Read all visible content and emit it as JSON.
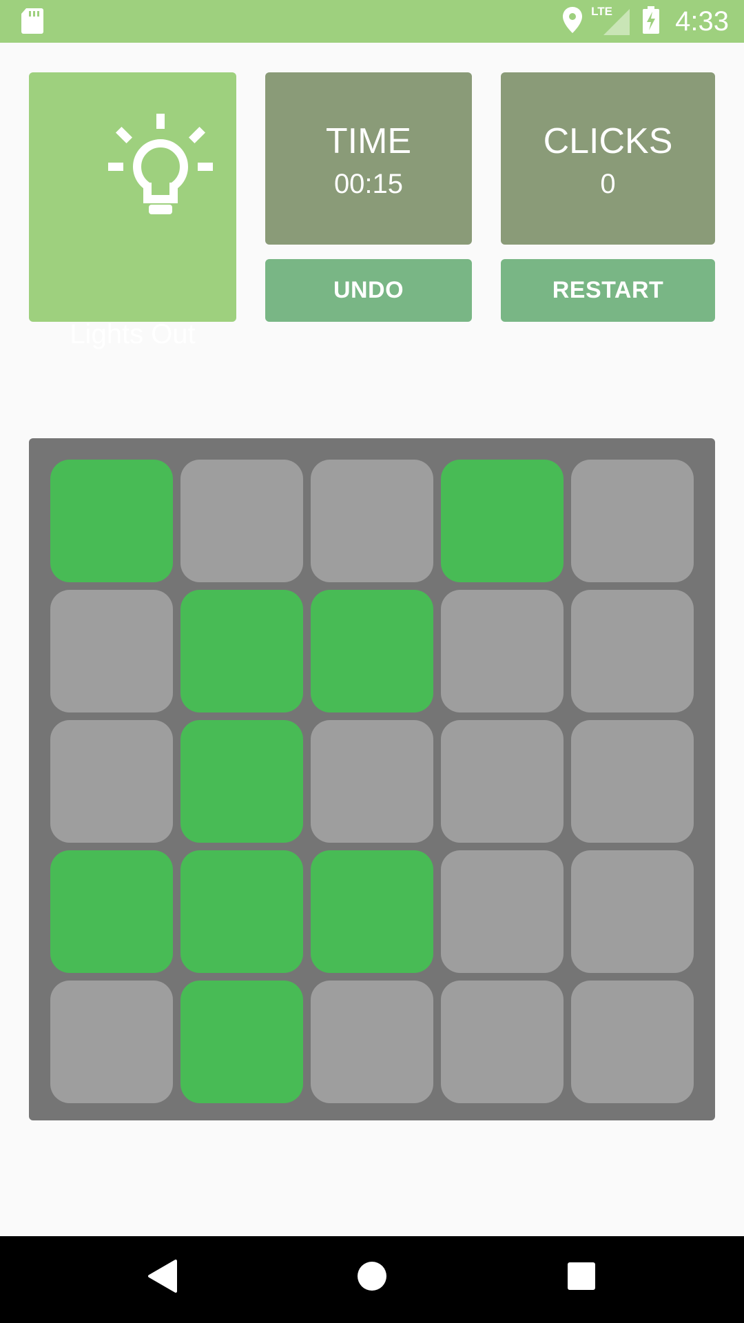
{
  "status_bar": {
    "time": "4:33",
    "network": "LTE",
    "icons": [
      "sd-card-icon",
      "location-icon",
      "signal-icon",
      "battery-charging-icon"
    ]
  },
  "app": {
    "title": "Lights Out",
    "logo_icon": "lightbulb-icon"
  },
  "stats": {
    "time_label": "TIME",
    "time_value": "00:15",
    "clicks_label": "CLICKS",
    "clicks_value": "0"
  },
  "actions": {
    "undo_label": "UNDO",
    "restart_label": "RESTART"
  },
  "board": {
    "rows": 5,
    "cols": 5,
    "cells": [
      [
        true,
        false,
        false,
        true,
        false
      ],
      [
        false,
        true,
        true,
        false,
        false
      ],
      [
        false,
        true,
        false,
        false,
        false
      ],
      [
        true,
        true,
        true,
        false,
        false
      ],
      [
        false,
        true,
        false,
        false,
        false
      ]
    ]
  },
  "colors": {
    "header_green": "#9ed07e",
    "stat_card": "#8a9b78",
    "button_green": "#79b685",
    "cell_on": "#48bb55",
    "cell_off": "#9e9e9e",
    "board_bg": "#757575"
  },
  "nav_bar": {
    "icons": [
      "back-icon",
      "home-icon",
      "recents-icon"
    ]
  }
}
